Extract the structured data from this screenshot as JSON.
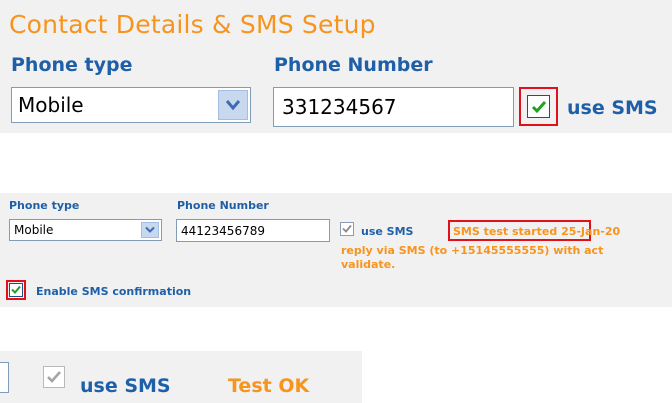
{
  "panel1": {
    "title": "Contact Details & SMS Setup",
    "phone_type_label": "Phone type",
    "phone_number_label": "Phone Number",
    "phone_type_value": "Mobile",
    "phone_number_value": "331234567",
    "use_sms_label": "use SMS",
    "use_sms_checked": true
  },
  "panel2": {
    "phone_type_label": "Phone type",
    "phone_number_label": "Phone Number",
    "phone_type_value": "Mobile",
    "phone_number_value": "44123456789",
    "use_sms_label": "use SMS",
    "status_highlight": "SMS test started",
    "status_line1_rest": " 25-Jan-20",
    "status_line2": "reply via SMS (to +15145555555) with act",
    "status_line3": "validate.",
    "enable_confirmation_label": "Enable SMS confirmation"
  },
  "panel3": {
    "use_sms_label": "use SMS",
    "test_status": "Test OK",
    "use_sms_checked": true
  },
  "colors": {
    "accent_orange": "#f7941d",
    "label_blue": "#1f5fa8",
    "highlight_red": "#e1101a",
    "panel_bg": "#f1f1f1"
  }
}
